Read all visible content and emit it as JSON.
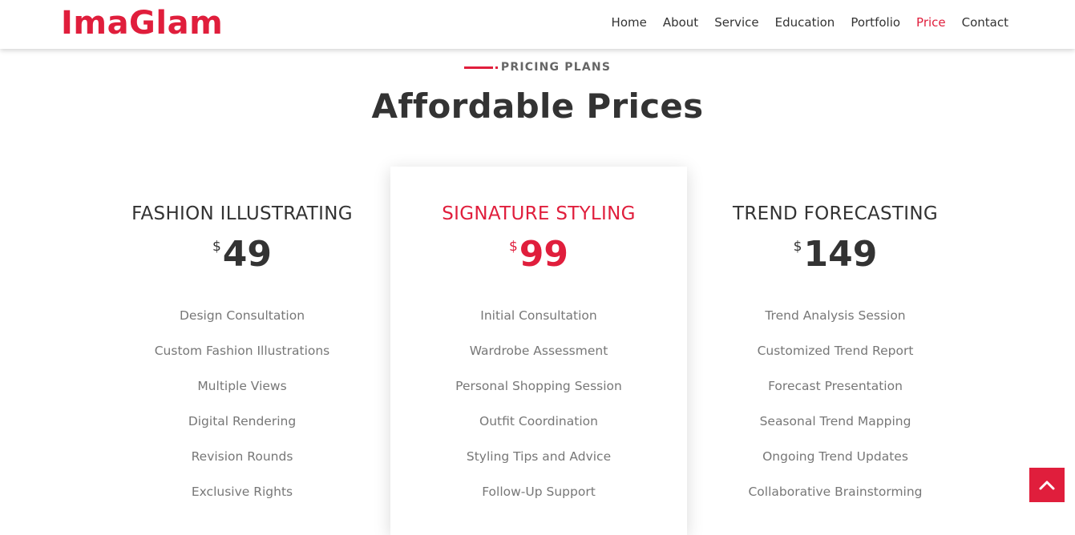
{
  "brand": {
    "logo": "ImaGlam",
    "accent_color": "#e01e3c"
  },
  "nav": {
    "items": [
      {
        "label": "Home"
      },
      {
        "label": "About"
      },
      {
        "label": "Service"
      },
      {
        "label": "Education"
      },
      {
        "label": "Portfolio"
      },
      {
        "label": "Price",
        "active": true
      },
      {
        "label": "Contact"
      }
    ]
  },
  "section": {
    "eyebrow": "PRICING PLANS",
    "title": "Affordable Prices"
  },
  "plans": [
    {
      "name": "FASHION ILLUSTRATING",
      "currency": "$",
      "price": "49",
      "features": [
        "Design Consultation",
        "Custom Fashion Illustrations",
        "Multiple Views",
        "Digital Rendering",
        "Revision Rounds",
        "Exclusive Rights"
      ]
    },
    {
      "name": "SIGNATURE STYLING",
      "currency": "$",
      "price": "99",
      "featured": true,
      "features": [
        "Initial Consultation",
        "Wardrobe Assessment",
        "Personal Shopping Session",
        "Outfit Coordination",
        "Styling Tips and Advice",
        "Follow-Up Support"
      ]
    },
    {
      "name": "TREND FORECASTING",
      "currency": "$",
      "price": "149",
      "features": [
        "Trend Analysis Session",
        "Customized Trend Report",
        "Forecast Presentation",
        "Seasonal Trend Mapping",
        "Ongoing Trend Updates",
        "Collaborative Brainstorming"
      ]
    }
  ],
  "scroll_top": {
    "icon": "chevron-up-icon"
  }
}
